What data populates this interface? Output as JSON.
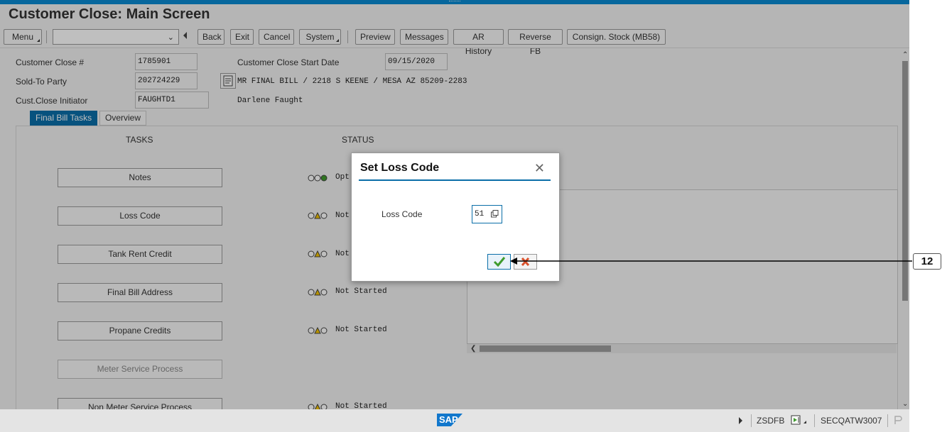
{
  "window": {
    "title": "Customer Close: Main Screen"
  },
  "toolbar": {
    "menu": "Menu",
    "back": "Back",
    "exit": "Exit",
    "cancel": "Cancel",
    "system": "System",
    "preview": "Preview",
    "messages": "Messages",
    "ar_history": "AR History",
    "reverse_fb": "Reverse FB",
    "consign_stock": "Consign. Stock (MB58)",
    "command_value": ""
  },
  "header": {
    "customer_close_label": "Customer Close #",
    "customer_close_value": "1785901",
    "start_date_label": "Customer Close Start Date",
    "start_date_value": "09/15/2020",
    "sold_to_label": "Sold-To Party",
    "sold_to_value": "202724229",
    "sold_to_address": "MR FINAL BILL / 2218 S KEENE / MESA AZ 85209-2283",
    "initiator_label": "Cust.Close Initiator",
    "initiator_value": "FAUGHTD1",
    "initiator_name": "Darlene Faught"
  },
  "tabs": [
    {
      "label": "Final Bill Tasks",
      "active": true
    },
    {
      "label": "Overview",
      "active": false
    }
  ],
  "columns": {
    "tasks": "TASKS",
    "status": "STATUS"
  },
  "tasks": [
    {
      "label": "Notes",
      "status": "Opt",
      "light": "green"
    },
    {
      "label": "Loss Code",
      "status": "Not",
      "light": "yellow"
    },
    {
      "label": "Tank Rent Credit",
      "status": "Not",
      "light": "yellow"
    },
    {
      "label": "Final Bill Address",
      "status": "Not Started",
      "light": "yellow"
    },
    {
      "label": "Propane Credits",
      "status": "Not Started",
      "light": "yellow"
    },
    {
      "label": "Meter Service Process",
      "status": "",
      "light": ""
    },
    {
      "label": "Non Meter Service Process",
      "status": "Not Started",
      "light": "yellow"
    }
  ],
  "dialog": {
    "title": "Set Loss Code",
    "field_label": "Loss Code",
    "field_value": "51",
    "ok_icon": "checkmark-icon",
    "cancel_icon": "cancel-x-icon"
  },
  "statusbar": {
    "logo": "SAP",
    "transaction": "ZSDFB",
    "system": "SECQATW3007"
  },
  "callout": {
    "label": "12"
  },
  "colors": {
    "accent": "#0a6ea8",
    "topbar": "#0a8ad2",
    "ok_green": "#3f9b2d",
    "cancel_red": "#d9512c"
  }
}
